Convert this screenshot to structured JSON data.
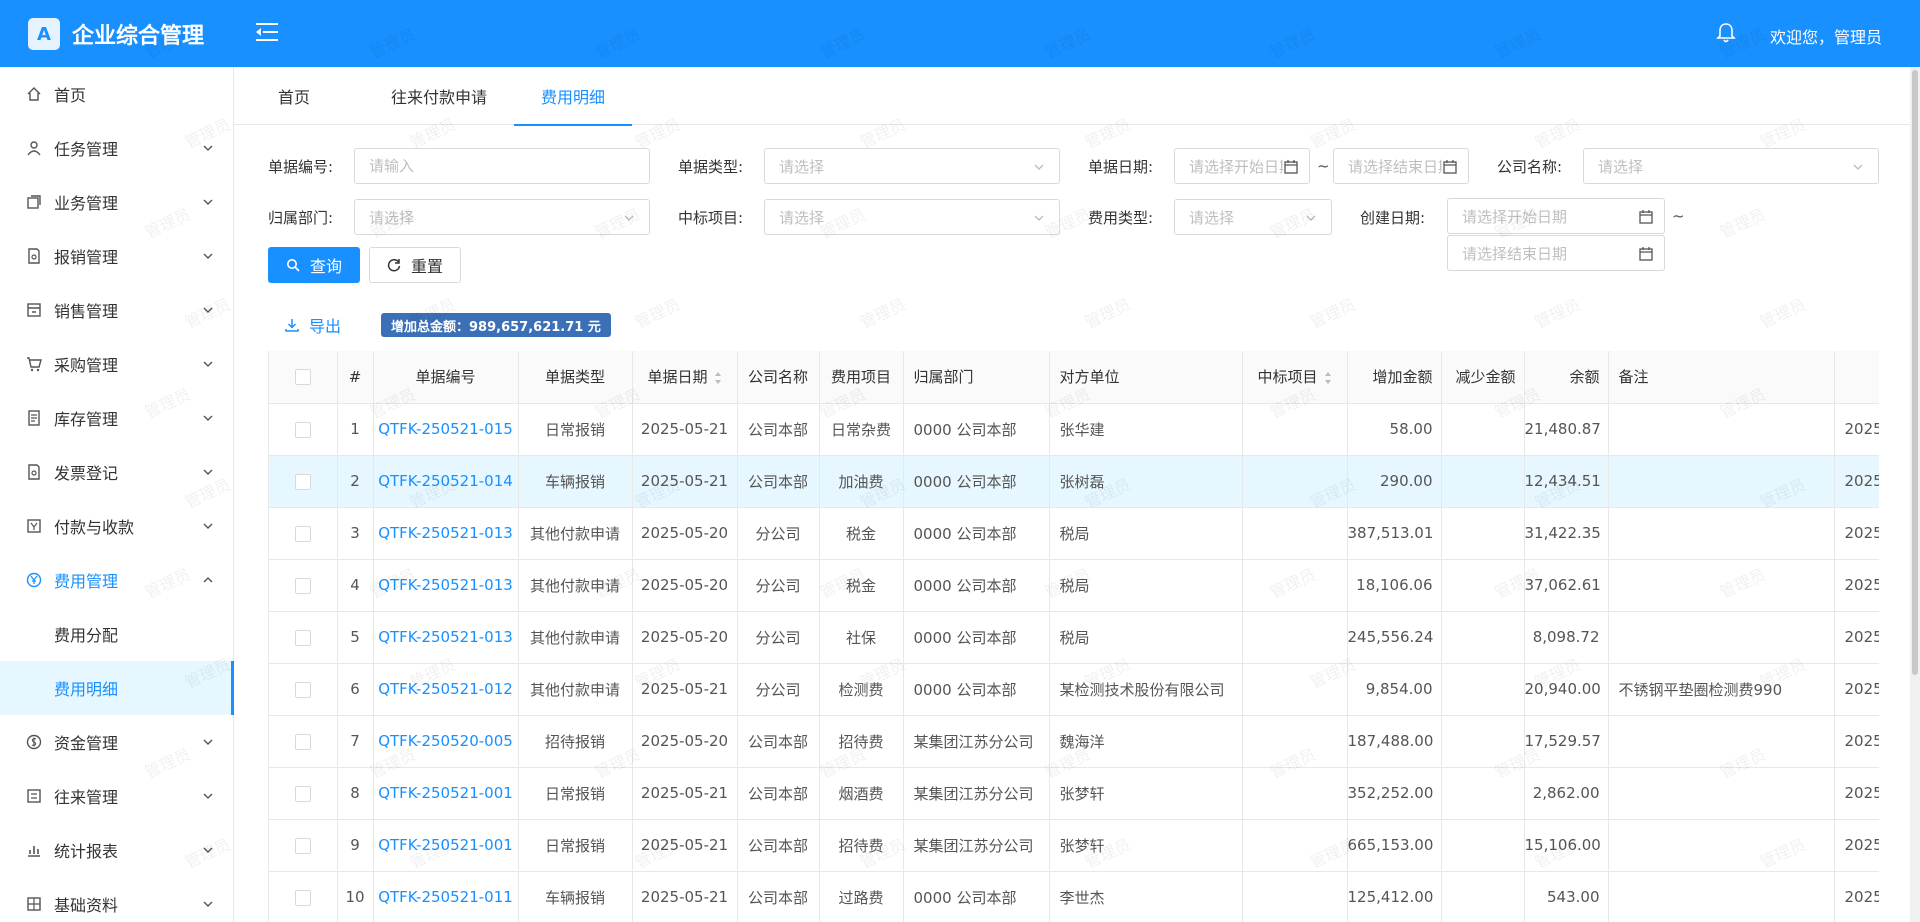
{
  "app": {
    "title": "企业综合管理",
    "logo_glyph": "A",
    "welcome": "欢迎您，管理员"
  },
  "watermark": "管理员",
  "sidebar": {
    "items": [
      {
        "label": "首页",
        "icon": "home-icon",
        "chevron": false
      },
      {
        "label": "任务管理",
        "icon": "user-icon",
        "chevron": true
      },
      {
        "label": "业务管理",
        "icon": "layers-icon",
        "chevron": true
      },
      {
        "label": "报销管理",
        "icon": "file-search-icon",
        "chevron": true
      },
      {
        "label": "销售管理",
        "icon": "shop-icon",
        "chevron": true
      },
      {
        "label": "采购管理",
        "icon": "cart-icon",
        "chevron": true
      },
      {
        "label": "库存管理",
        "icon": "inventory-icon",
        "chevron": true
      },
      {
        "label": "发票登记",
        "icon": "invoice-icon",
        "chevron": true
      },
      {
        "label": "付款与收款",
        "icon": "payment-icon",
        "chevron": true
      },
      {
        "label": "费用管理",
        "icon": "yen-circle-icon",
        "chevron": true,
        "expanded": true
      },
      {
        "label": "费用分配",
        "sub": true
      },
      {
        "label": "费用明细",
        "sub": true,
        "selected": true
      },
      {
        "label": "资金管理",
        "icon": "dollar-circle-icon",
        "chevron": true
      },
      {
        "label": "往来管理",
        "icon": "exchange-icon",
        "chevron": true
      },
      {
        "label": "统计报表",
        "icon": "chart-icon",
        "chevron": true
      },
      {
        "label": "基础资料",
        "icon": "grid-icon",
        "chevron": true
      }
    ]
  },
  "tabs": [
    {
      "label": "首页"
    },
    {
      "label": "往来付款申请"
    },
    {
      "label": "费用明细",
      "active": true
    }
  ],
  "filters": {
    "doc_no": {
      "label": "单据编号:",
      "placeholder": "请输入"
    },
    "doc_type": {
      "label": "单据类型:",
      "placeholder": "请选择"
    },
    "doc_date": {
      "label": "单据日期:",
      "start_placeholder": "请选择开始日期",
      "end_placeholder": "请选择结束日期",
      "sep": "~"
    },
    "company": {
      "label": "公司名称:",
      "placeholder": "请选择"
    },
    "dept": {
      "label": "归属部门:",
      "placeholder": "请选择"
    },
    "project": {
      "label": "中标项目:",
      "placeholder": "请选择"
    },
    "fee_type": {
      "label": "费用类型:",
      "placeholder": "请选择"
    },
    "create_date": {
      "label": "创建日期:",
      "start_placeholder": "请选择开始日期",
      "end_placeholder": "请选择结束日期",
      "sep": "~"
    }
  },
  "actions": {
    "query": "查询",
    "reset": "重置",
    "export": "导出",
    "total": "增加总金额：989,657,621.71 元"
  },
  "table": {
    "headers": [
      "#",
      "单据编号",
      "单据类型",
      "单据日期",
      "公司名称",
      "费用项目",
      "归属部门",
      "对方单位",
      "中标项目",
      "增加金额",
      "减少金额",
      "余额",
      "备注",
      "创"
    ],
    "rows": [
      {
        "n": "1",
        "no": "QTFK-250521-015",
        "type": "日常报销",
        "date": "2025-05-21",
        "company": "公司本部",
        "item": "日常杂费",
        "dept": "0000 公司本部",
        "party": "张华建",
        "project": "",
        "inc": "58.00",
        "dec": "",
        "bal": "21,480.87",
        "note": "",
        "created": "2025-0"
      },
      {
        "n": "2",
        "no": "QTFK-250521-014",
        "type": "车辆报销",
        "date": "2025-05-21",
        "company": "公司本部",
        "item": "加油费",
        "dept": "0000 公司本部",
        "party": "张树磊",
        "project": "",
        "inc": "290.00",
        "dec": "",
        "bal": "12,434.51",
        "note": "",
        "created": "2025-0",
        "hl": true
      },
      {
        "n": "3",
        "no": "QTFK-250521-013",
        "type": "其他付款申请",
        "date": "2025-05-20",
        "company": "分公司",
        "item": "税金",
        "dept": "0000 公司本部",
        "party": "税局",
        "project": "",
        "inc": "387,513.01",
        "dec": "",
        "bal": "31,422.35",
        "note": "",
        "created": "2025-0"
      },
      {
        "n": "4",
        "no": "QTFK-250521-013",
        "type": "其他付款申请",
        "date": "2025-05-20",
        "company": "分公司",
        "item": "税金",
        "dept": "0000 公司本部",
        "party": "税局",
        "project": "",
        "inc": "18,106.06",
        "dec": "",
        "bal": "37,062.61",
        "note": "",
        "created": "2025-0"
      },
      {
        "n": "5",
        "no": "QTFK-250521-013",
        "type": "其他付款申请",
        "date": "2025-05-20",
        "company": "分公司",
        "item": "社保",
        "dept": "0000 公司本部",
        "party": "税局",
        "project": "",
        "inc": "245,556.24",
        "dec": "",
        "bal": "8,098.72",
        "note": "",
        "created": "2025-0"
      },
      {
        "n": "6",
        "no": "QTFK-250521-012",
        "type": "其他付款申请",
        "date": "2025-05-21",
        "company": "分公司",
        "item": "检测费",
        "dept": "0000 公司本部",
        "party": "某检测技术股份有限公司",
        "project": "",
        "inc": "9,854.00",
        "dec": "",
        "bal": "20,940.00",
        "note": "不锈钢平垫圈检测费990",
        "created": "2025-0"
      },
      {
        "n": "7",
        "no": "QTFK-250520-005",
        "type": "招待报销",
        "date": "2025-05-20",
        "company": "公司本部",
        "item": "招待费",
        "dept": "某集团江苏分公司",
        "party": "魏海洋",
        "project": "",
        "inc": "187,488.00",
        "dec": "",
        "bal": "17,529.57",
        "note": "",
        "created": "2025-0"
      },
      {
        "n": "8",
        "no": "QTFK-250521-001",
        "type": "日常报销",
        "date": "2025-05-21",
        "company": "公司本部",
        "item": "烟酒费",
        "dept": "某集团江苏分公司",
        "party": "张梦轩",
        "project": "",
        "inc": "352,252.00",
        "dec": "",
        "bal": "2,862.00",
        "note": "",
        "created": "2025-0"
      },
      {
        "n": "9",
        "no": "QTFK-250521-001",
        "type": "日常报销",
        "date": "2025-05-21",
        "company": "公司本部",
        "item": "招待费",
        "dept": "某集团江苏分公司",
        "party": "张梦轩",
        "project": "",
        "inc": "665,153.00",
        "dec": "",
        "bal": "15,106.00",
        "note": "",
        "created": "2025-0"
      },
      {
        "n": "10",
        "no": "QTFK-250521-011",
        "type": "车辆报销",
        "date": "2025-05-21",
        "company": "公司本部",
        "item": "过路费",
        "dept": "0000 公司本部",
        "party": "李世杰",
        "project": "",
        "inc": "125,412.00",
        "dec": "",
        "bal": "543.00",
        "note": "",
        "created": "2025-0"
      }
    ]
  },
  "colors": {
    "primary": "#1890ff",
    "highlight_row": "#e6f7ff",
    "badge": "#3b6fb6"
  }
}
